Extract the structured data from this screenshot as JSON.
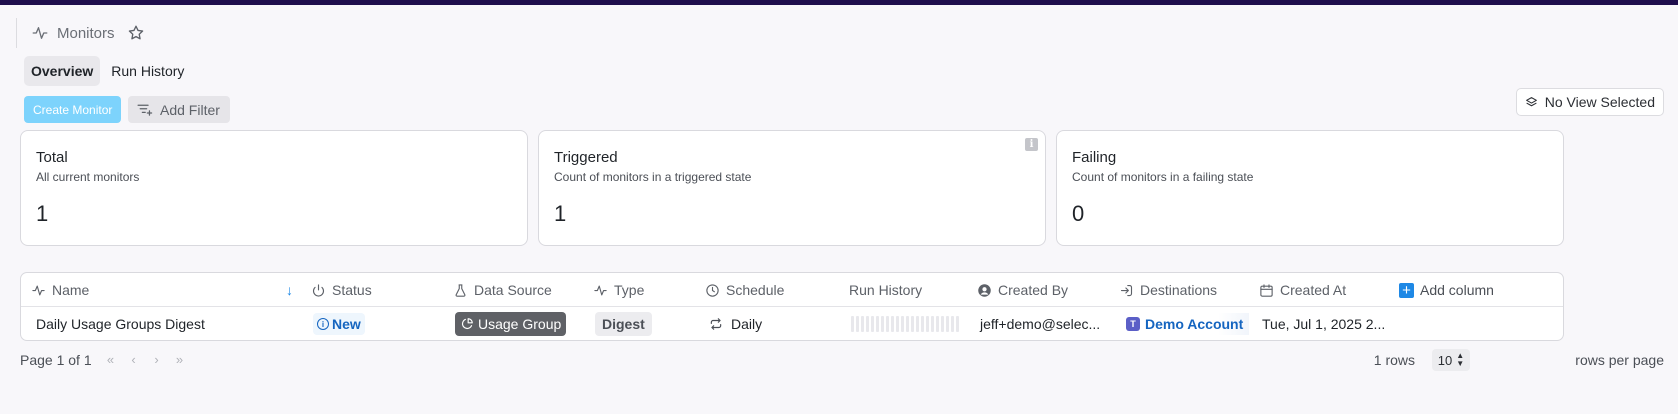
{
  "header": {
    "title": "Monitors"
  },
  "tabs": [
    {
      "label": "Overview",
      "active": true
    },
    {
      "label": "Run History",
      "active": false
    }
  ],
  "toolbar": {
    "create_label": "Create Monitor",
    "filter_label": "Add Filter",
    "view_label": "No View Selected"
  },
  "cards": [
    {
      "title": "Total",
      "desc": "All current monitors",
      "value": "1"
    },
    {
      "title": "Triggered",
      "desc": "Count of monitors in a triggered state",
      "value": "1"
    },
    {
      "title": "Failing",
      "desc": "Count of monitors in a failing state",
      "value": "0"
    }
  ],
  "table": {
    "columns": {
      "name": "Name",
      "status": "Status",
      "source": "Data Source",
      "type": "Type",
      "schedule": "Schedule",
      "history": "Run History",
      "created_by": "Created By",
      "destinations": "Destinations",
      "created_at": "Created At",
      "add_column": "Add column"
    },
    "rows": [
      {
        "name": "Daily Usage Groups Digest",
        "status": "New",
        "source": "Usage Group",
        "type": "Digest",
        "schedule": "Daily",
        "created_by": "jeff+demo@selec...",
        "destination": "Demo Account",
        "created_at": "Tue, Jul 1, 2025 2..."
      }
    ]
  },
  "pagination": {
    "page_info": "Page 1 of 1",
    "rows_count": "1 rows",
    "per_page_value": "10",
    "per_page_label": "rows per page"
  },
  "colors": {
    "accent": "#1e88e5",
    "create_button": "#7dd3fc",
    "topbar": "#1f0e4d"
  }
}
